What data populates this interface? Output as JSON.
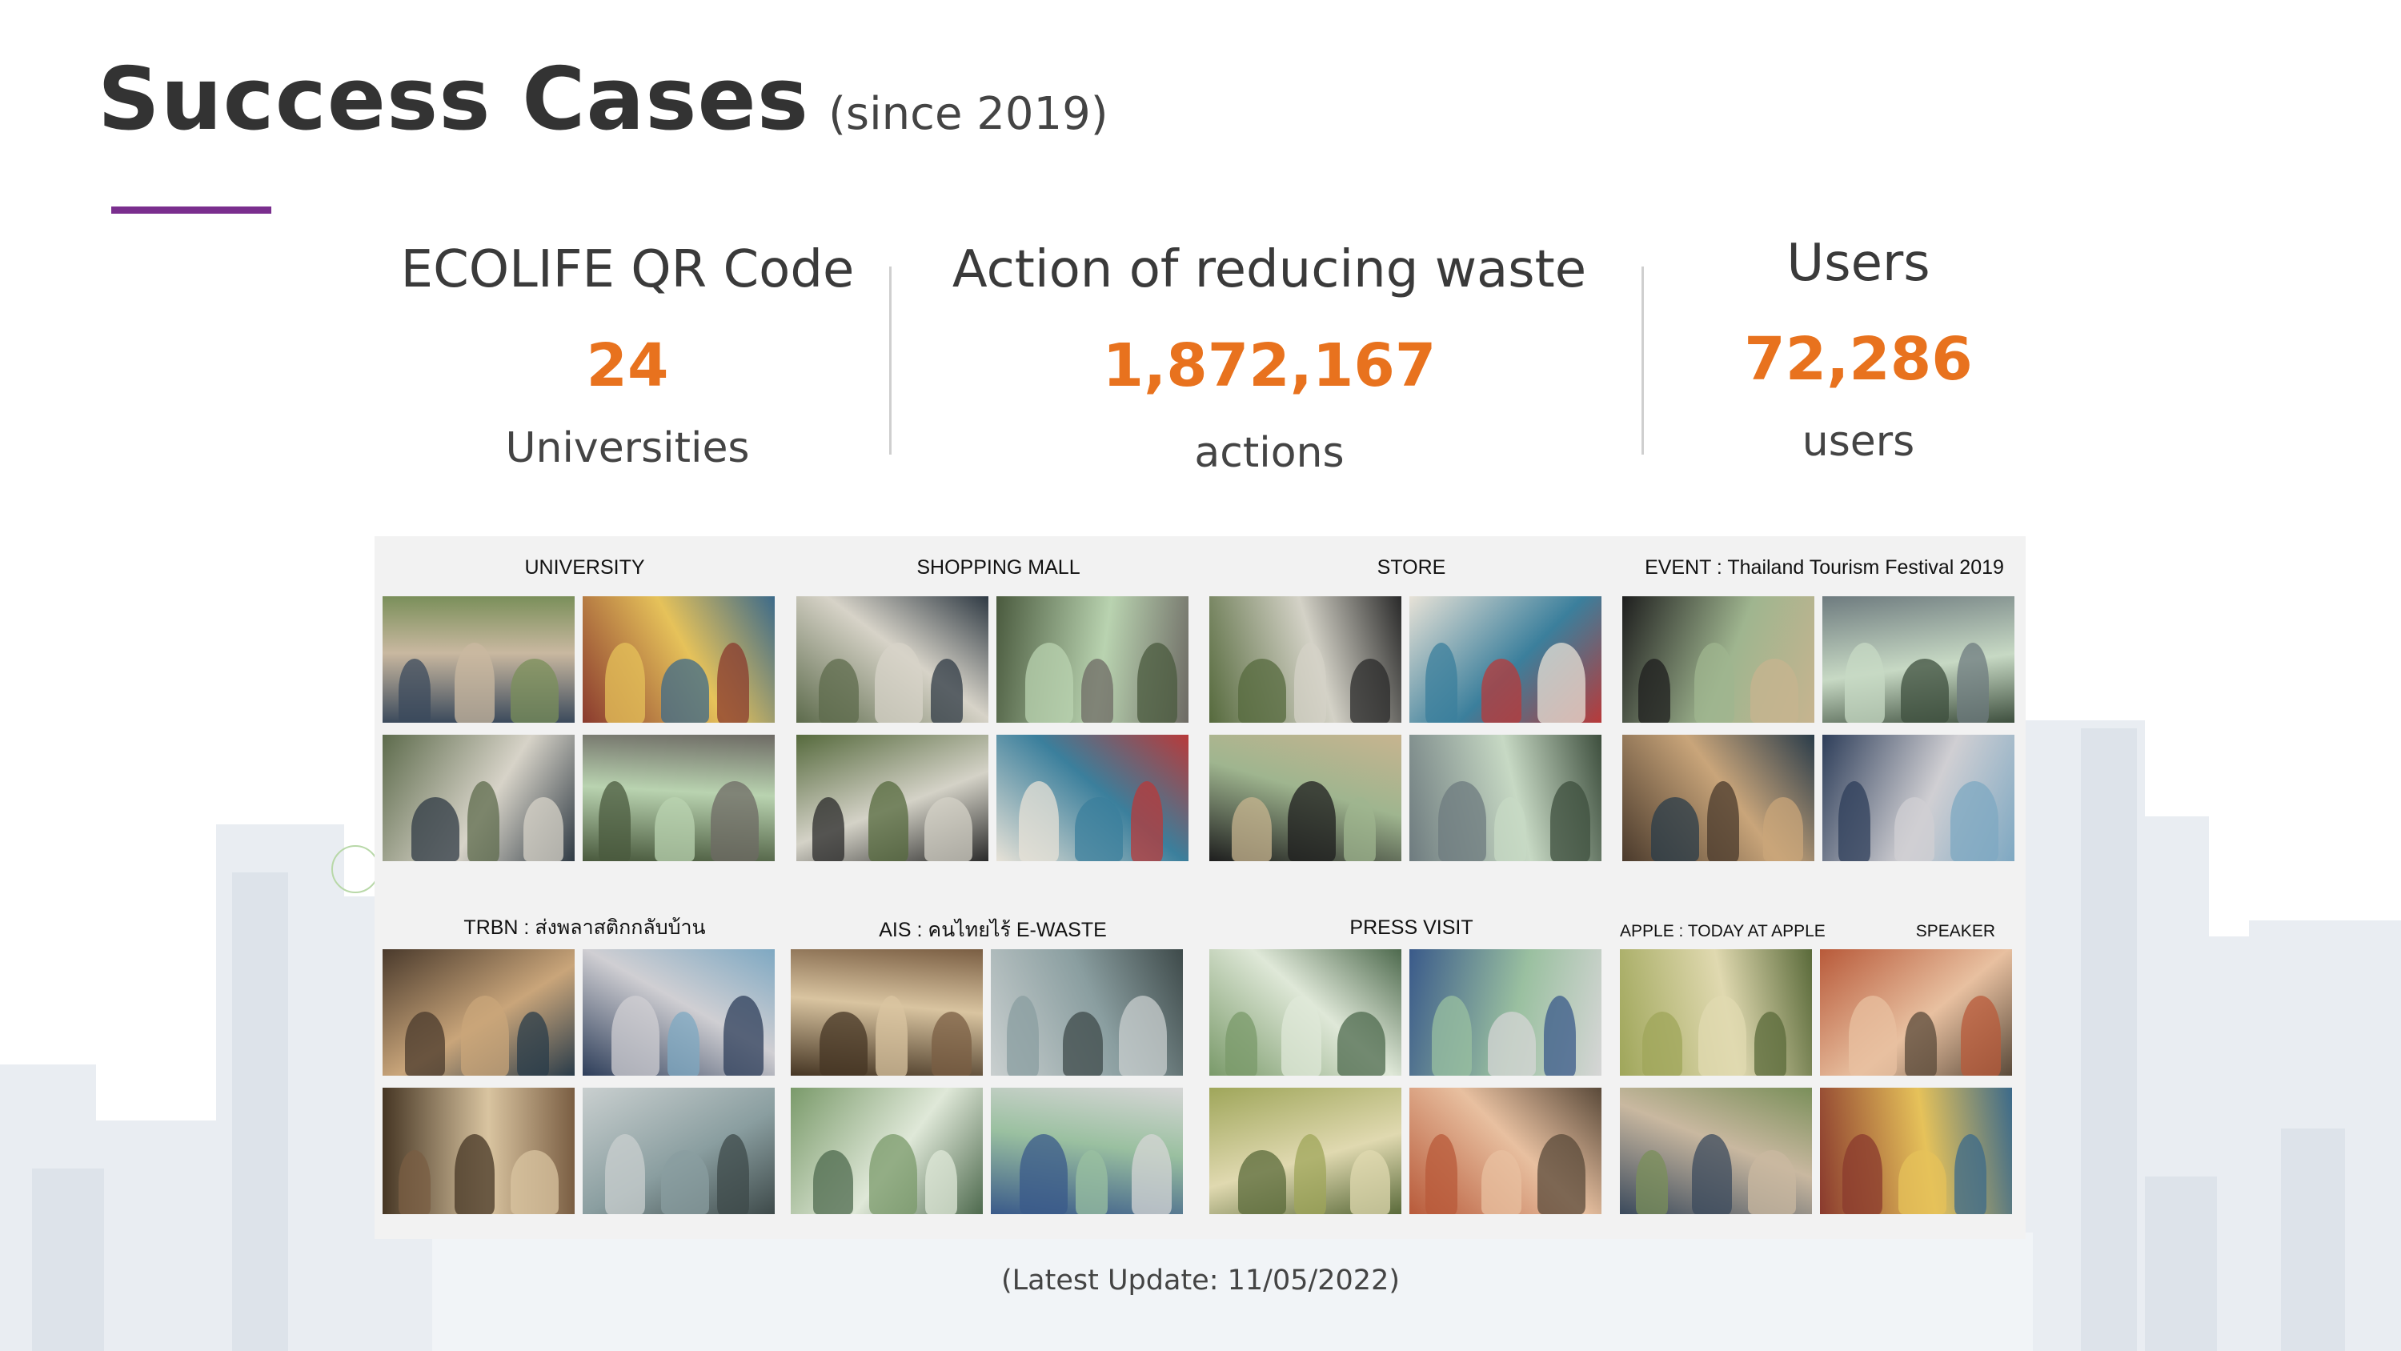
{
  "header": {
    "title": "Success Cases",
    "subtitle": "(since 2019)"
  },
  "colors": {
    "accent_purple": "#7a2e8e",
    "number_orange": "#e8721e",
    "title_gray": "#333333"
  },
  "stats": [
    {
      "label": "ECOLIFE QR Code",
      "value": "24",
      "unit": "Universities"
    },
    {
      "label": "Action of reducing waste",
      "value": "1,872,167",
      "unit": "actions"
    },
    {
      "label": "Users",
      "value": "72,286",
      "unit": "users"
    }
  ],
  "collage": {
    "groups": [
      {
        "label": "UNIVERSITY"
      },
      {
        "label": "SHOPPING MALL"
      },
      {
        "label": "STORE"
      },
      {
        "label": "EVENT : Thailand Tourism Festival 2019"
      },
      {
        "label": "TRBN : ส่งพลาสติกกลับบ้าน"
      },
      {
        "label": "AIS : คนไทยไร้ E-WASTE"
      },
      {
        "label": "PRESS VISIT"
      },
      {
        "label": "APPLE : TODAY AT APPLE",
        "label2": "SPEAKER"
      }
    ]
  },
  "footer": {
    "update": "(Latest Update: 11/05/2022)"
  }
}
